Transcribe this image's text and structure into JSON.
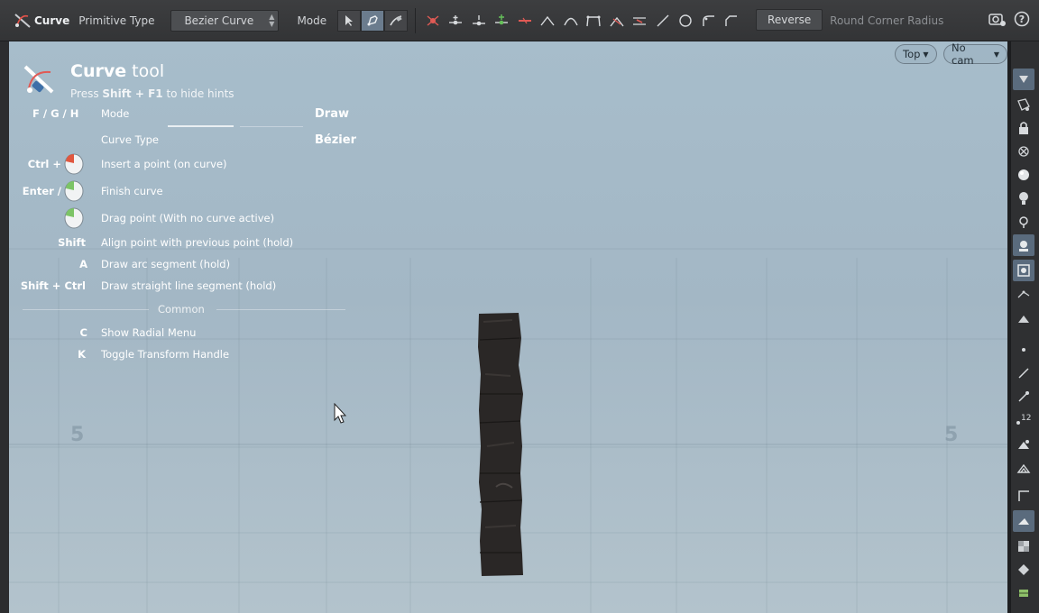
{
  "toolbar": {
    "tool_name": "Curve",
    "primitive_type_label": "Primitive Type",
    "primitive_type_value": "Bezier Curve",
    "mode_label": "Mode",
    "reverse_label": "Reverse",
    "round_corner_label": "Round Corner Radius"
  },
  "viewport": {
    "view_menu": "Top",
    "camera_menu": "No cam",
    "axis_labels": [
      "5",
      "5"
    ]
  },
  "hints": {
    "title_bold": "Curve",
    "title_rest": " tool",
    "subtitle_pre": "Press ",
    "subtitle_keys": "Shift + F1",
    "subtitle_post": " to hide hints",
    "mode_keys": "F / G / H",
    "mode_label": "Mode",
    "mode_value": "Draw",
    "curve_type_label": "Curve Type",
    "curve_type_value": "Bézier",
    "rows": [
      {
        "key": "Ctrl +",
        "label": "Insert a point (on curve)"
      },
      {
        "key": "Enter /",
        "label": "Finish curve"
      },
      {
        "key": "",
        "label": "Drag point (With no curve active)"
      },
      {
        "key": "Shift",
        "label": "Align point with previous point (hold)"
      },
      {
        "key": "A",
        "label": "Draw arc segment (hold)"
      },
      {
        "key": "Shift + Ctrl",
        "label": "Draw straight line segment (hold)"
      }
    ],
    "section_common": "Common",
    "common_rows": [
      {
        "key": "C",
        "label": "Show Radial Menu"
      },
      {
        "key": "K",
        "label": "Toggle Transform Handle"
      }
    ]
  },
  "shelf": {
    "badge_number": "12"
  },
  "colors": {
    "toolbar_bg": "#38393b",
    "viewport_top": "#a7bdcb",
    "viewport_bottom": "#b3c3cc",
    "active_button": "#6b7c8e",
    "object_color": "#2a2726"
  }
}
